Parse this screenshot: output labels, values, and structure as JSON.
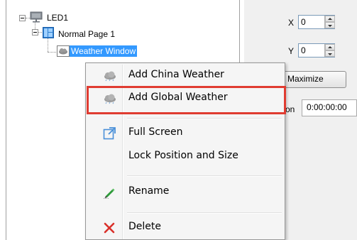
{
  "tree": {
    "root_label": "LED1",
    "page_label": "Normal Page 1",
    "window_label": "Weather Window"
  },
  "properties": {
    "x_label": "X",
    "x_value": "0",
    "y_label": "Y",
    "y_value": "0",
    "maximize_label": "Maximize",
    "partial_label": "on",
    "duration_value": "0:00:00:00"
  },
  "context_menu": {
    "items": [
      {
        "label": "Add China Weather",
        "icon": "cloud-icon"
      },
      {
        "label": "Add Global Weather",
        "icon": "cloud-icon",
        "highlighted": true
      },
      {
        "label": "Full Screen",
        "icon": "fullscreen-icon"
      },
      {
        "label": "Lock Position and Size",
        "icon": ""
      },
      {
        "label": "Rename",
        "icon": "pen-icon"
      },
      {
        "label": "Delete",
        "icon": "delete-x-icon"
      }
    ]
  },
  "colors": {
    "selection": "#3399ff",
    "highlight_border": "#e03c31",
    "delete_icon": "#d9302a"
  }
}
